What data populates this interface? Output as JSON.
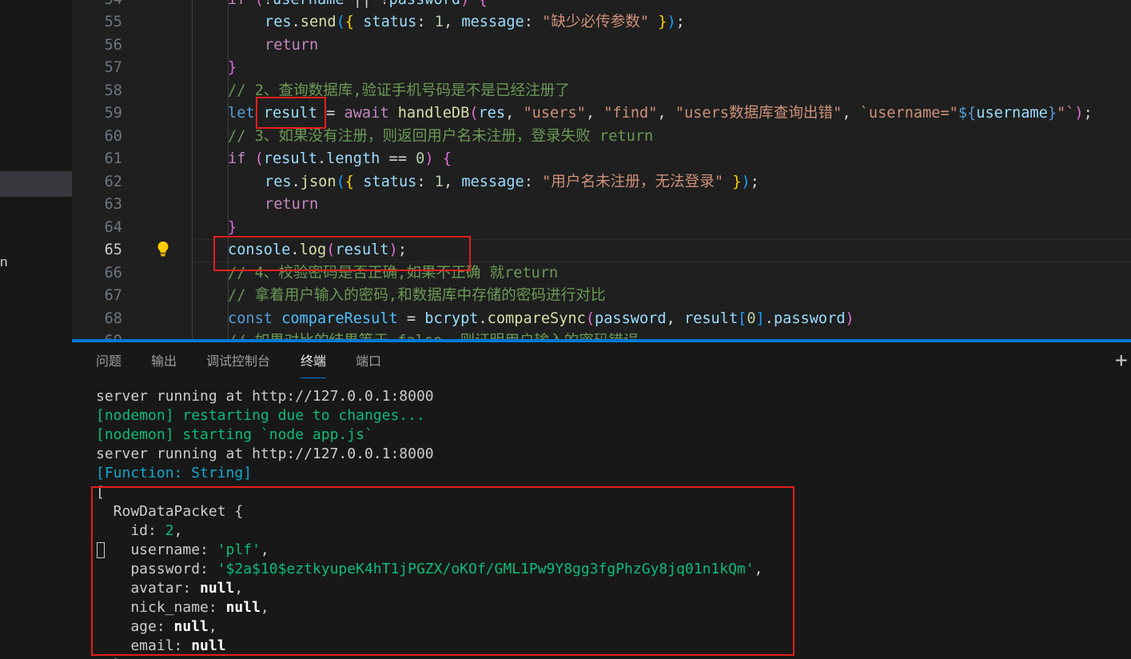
{
  "editor": {
    "lines": [
      {
        "n": "54",
        "tokens": [
          [
            "kw2",
            "if "
          ],
          [
            "br2",
            "("
          ],
          [
            "",
            "!"
          ],
          [
            "var",
            "username"
          ],
          [
            "",
            " || !"
          ],
          [
            "var",
            "password"
          ],
          [
            "br2",
            ")"
          ],
          [
            "",
            " "
          ],
          [
            "br2",
            "{"
          ]
        ]
      },
      {
        "n": "55",
        "tokens": [
          [
            "var",
            "res"
          ],
          [
            "",
            "."
          ],
          [
            "fn",
            "send"
          ],
          [
            "br3",
            "("
          ],
          [
            "br1",
            "{"
          ],
          [
            "",
            " "
          ],
          [
            "var",
            "status"
          ],
          [
            "",
            ": "
          ],
          [
            "num",
            "1"
          ],
          [
            "",
            ", "
          ],
          [
            "var",
            "message"
          ],
          [
            "",
            ": "
          ],
          [
            "str",
            "\"缺少必传参数\""
          ],
          [
            "",
            " "
          ],
          [
            "br1",
            "}"
          ],
          [
            "br3",
            ")"
          ],
          [
            "",
            ";"
          ]
        ]
      },
      {
        "n": "56",
        "tokens": [
          [
            "kw2",
            "return"
          ]
        ]
      },
      {
        "n": "57",
        "tokens": [
          [
            "br2",
            "}"
          ]
        ]
      },
      {
        "n": "58",
        "tokens": [
          [
            "cm",
            "// 2、查询数据库,验证手机号码是不是已经注册了"
          ]
        ]
      },
      {
        "n": "59",
        "tokens": [
          [
            "kw",
            "let "
          ],
          [
            "var",
            "result"
          ],
          [
            "",
            " = "
          ],
          [
            "kw2",
            "await "
          ],
          [
            "fn",
            "handleDB"
          ],
          [
            "br2",
            "("
          ],
          [
            "var",
            "res"
          ],
          [
            "",
            ", "
          ],
          [
            "str",
            "\"users\""
          ],
          [
            "",
            ", "
          ],
          [
            "str",
            "\"find\""
          ],
          [
            "",
            ", "
          ],
          [
            "str",
            "\"users数据库查询出错\""
          ],
          [
            "",
            ", "
          ],
          [
            "str",
            "`username=\""
          ],
          [
            "kw",
            "${"
          ],
          [
            "var",
            "username"
          ],
          [
            "kw",
            "}"
          ],
          [
            "str",
            "\"`"
          ],
          [
            "br2",
            ")"
          ],
          [
            "",
            ";"
          ]
        ]
      },
      {
        "n": "60",
        "tokens": [
          [
            "cm",
            "// 3、如果没有注册，则返回用户名未注册，登录失败 return"
          ]
        ]
      },
      {
        "n": "61",
        "tokens": [
          [
            "kw2",
            "if "
          ],
          [
            "br2",
            "("
          ],
          [
            "var",
            "result"
          ],
          [
            "",
            "."
          ],
          [
            "var",
            "length"
          ],
          [
            "",
            " == "
          ],
          [
            "num",
            "0"
          ],
          [
            "br2",
            ")"
          ],
          [
            "",
            " "
          ],
          [
            "br2",
            "{"
          ]
        ]
      },
      {
        "n": "62",
        "tokens": [
          [
            "var",
            "res"
          ],
          [
            "",
            "."
          ],
          [
            "fn",
            "json"
          ],
          [
            "br3",
            "("
          ],
          [
            "br1",
            "{"
          ],
          [
            "",
            " "
          ],
          [
            "var",
            "status"
          ],
          [
            "",
            ": "
          ],
          [
            "num",
            "1"
          ],
          [
            "",
            ", "
          ],
          [
            "var",
            "message"
          ],
          [
            "",
            ": "
          ],
          [
            "str",
            "\"用户名未注册，无法登录\""
          ],
          [
            "",
            " "
          ],
          [
            "br1",
            "}"
          ],
          [
            "br3",
            ")"
          ],
          [
            "",
            ";"
          ]
        ]
      },
      {
        "n": "63",
        "tokens": [
          [
            "kw2",
            "return"
          ]
        ]
      },
      {
        "n": "64",
        "tokens": [
          [
            "br2",
            "}"
          ]
        ]
      },
      {
        "n": "65",
        "tokens": [
          [
            "var",
            "console"
          ],
          [
            "",
            "."
          ],
          [
            "fn",
            "log"
          ],
          [
            "br2",
            "("
          ],
          [
            "var",
            "result"
          ],
          [
            "br2",
            ")"
          ],
          [
            "",
            ";"
          ]
        ]
      },
      {
        "n": "66",
        "tokens": [
          [
            "cm",
            "// 4、校验密码是否正确,如果不正确 就return"
          ]
        ]
      },
      {
        "n": "67",
        "tokens": [
          [
            "cm",
            "// 拿着用户输入的密码,和数据库中存储的密码进行对比"
          ]
        ]
      },
      {
        "n": "68",
        "tokens": [
          [
            "kw",
            "const "
          ],
          [
            "const",
            "compareResult"
          ],
          [
            "",
            " = "
          ],
          [
            "var",
            "bcrypt"
          ],
          [
            "",
            "."
          ],
          [
            "fn",
            "compareSync"
          ],
          [
            "br2",
            "("
          ],
          [
            "var",
            "password"
          ],
          [
            "",
            ", "
          ],
          [
            "var",
            "result"
          ],
          [
            "br3",
            "["
          ],
          [
            "num",
            "0"
          ],
          [
            "br3",
            "]"
          ],
          [
            "",
            "."
          ],
          [
            "var",
            "password"
          ],
          [
            "br2",
            ")"
          ]
        ]
      },
      {
        "n": "69",
        "tokens": [
          [
            "cm",
            "// 如果对比的结果等于 false, 则证明用户输入的密码错误"
          ]
        ]
      }
    ]
  },
  "sidebar": {
    "fragment": "n"
  },
  "panel": {
    "tabs": [
      "问题",
      "输出",
      "调试控制台",
      "终端",
      "端口"
    ],
    "active_tab": "终端",
    "new_terminal": "+",
    "terminal": [
      {
        "cls": "",
        "text": "server running at http://127.0.0.1:8000"
      },
      {
        "cls": "t-green",
        "text": "[nodemon] restarting due to changes..."
      },
      {
        "cls": "t-green",
        "text": "[nodemon] starting `node app.js`"
      },
      {
        "cls": "",
        "text": "server running at http://127.0.0.1:8000"
      },
      {
        "cls": "t-cyan",
        "text": "[Function: String]"
      },
      {
        "cls": "",
        "text": "["
      },
      {
        "cls": "",
        "text": "  RowDataPacket {"
      },
      {
        "cls": "",
        "parts": [
          [
            "",
            "    id: "
          ],
          [
            "t-green",
            "2"
          ],
          [
            "",
            ","
          ]
        ]
      },
      {
        "cls": "",
        "parts": [
          [
            "",
            "    username: "
          ],
          [
            "t-green",
            "'plf'"
          ],
          [
            "",
            ","
          ]
        ]
      },
      {
        "cls": "",
        "parts": [
          [
            "",
            "    password: "
          ],
          [
            "t-green",
            "'$2a$10$eztkyupeK4hT1jPGZX/oKOf/GML1Pw9Y8gg3fgPhzGy8jq01n1kQm'"
          ],
          [
            "",
            ","
          ]
        ]
      },
      {
        "cls": "",
        "parts": [
          [
            "",
            "    avatar: "
          ],
          [
            "t-bold",
            "null"
          ],
          [
            "",
            ","
          ]
        ]
      },
      {
        "cls": "",
        "parts": [
          [
            "",
            "    nick_name: "
          ],
          [
            "t-bold",
            "null"
          ],
          [
            "",
            ","
          ]
        ]
      },
      {
        "cls": "",
        "parts": [
          [
            "",
            "    age: "
          ],
          [
            "t-bold",
            "null"
          ],
          [
            "",
            ","
          ]
        ]
      },
      {
        "cls": "",
        "parts": [
          [
            "",
            "    email: "
          ],
          [
            "t-bold",
            "null"
          ]
        ]
      },
      {
        "cls": "",
        "text": "  }"
      }
    ]
  },
  "colors": {
    "accent": "#0078d4",
    "highlight": "#e51e1e"
  }
}
